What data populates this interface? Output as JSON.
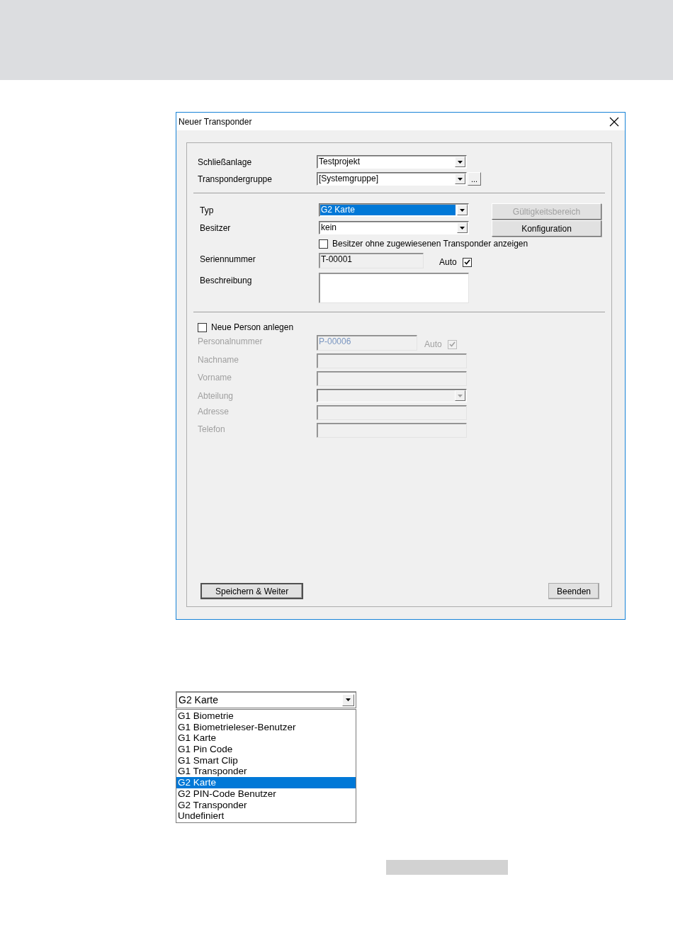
{
  "dialog": {
    "title": "Neuer Transponder",
    "sections": [
      {
        "rows": [
          {
            "kind": "combo",
            "label": "Schließanlage",
            "value": "Testprojekt"
          },
          {
            "kind": "combo",
            "label": "Transpondergruppe",
            "value": "[Systemgruppe]",
            "button": "..."
          }
        ]
      },
      {
        "rows": [
          {
            "kind": "combo",
            "label": "Typ",
            "value": "G2 Karte",
            "highlighted": true
          },
          {
            "kind": "combo",
            "label": "Besitzer",
            "value": "kein"
          },
          {
            "kind": "checkbox",
            "label": "Besitzer ohne zugewiesenen Transponder anzeigen",
            "checked": false
          },
          {
            "kind": "text",
            "label": "Seriennummer",
            "value": "T-00001",
            "auto": {
              "label": "Auto",
              "checked": true
            }
          },
          {
            "kind": "memo",
            "label": "Beschreibung"
          }
        ],
        "side_buttons": [
          {
            "label": "Gültigkeitsbereich",
            "disabled": true
          },
          {
            "label": "Konfiguration",
            "disabled": false
          }
        ]
      },
      {
        "rows": [
          {
            "kind": "toggle",
            "label": "Neue Person anlegen",
            "checked": false
          },
          {
            "kind": "text",
            "label": "Personalnummer",
            "value": "P-00006",
            "disabled": true,
            "auto": {
              "label": "Auto",
              "checked": true
            }
          },
          {
            "kind": "text",
            "label": "Nachname",
            "disabled": true
          },
          {
            "kind": "text",
            "label": "Vorname",
            "disabled": true
          },
          {
            "kind": "combo",
            "label": "Abteilung",
            "disabled": true
          },
          {
            "kind": "text",
            "label": "Adresse",
            "disabled": true
          },
          {
            "kind": "text",
            "label": "Telefon",
            "disabled": true
          }
        ]
      }
    ],
    "footer_buttons": [
      {
        "label": "Speichern & Weiter",
        "default": true
      },
      {
        "label": "Beenden",
        "default": false
      }
    ]
  },
  "dropdown": {
    "value": "G2 Karte",
    "options": [
      {
        "label": "G1 Biometrie",
        "selected": false
      },
      {
        "label": "G1 Biometrieleser-Benutzer",
        "selected": false
      },
      {
        "label": "G1 Karte",
        "selected": false
      },
      {
        "label": "G1 Pin Code",
        "selected": false
      },
      {
        "label": "G1 Smart Clip",
        "selected": false
      },
      {
        "label": "G1 Transponder",
        "selected": false
      },
      {
        "label": "G2 Karte",
        "selected": true
      },
      {
        "label": "G2 PIN-Code Benutzer",
        "selected": false
      },
      {
        "label": "G2 Transponder",
        "selected": false
      },
      {
        "label": "Undefiniert",
        "selected": false
      }
    ]
  }
}
